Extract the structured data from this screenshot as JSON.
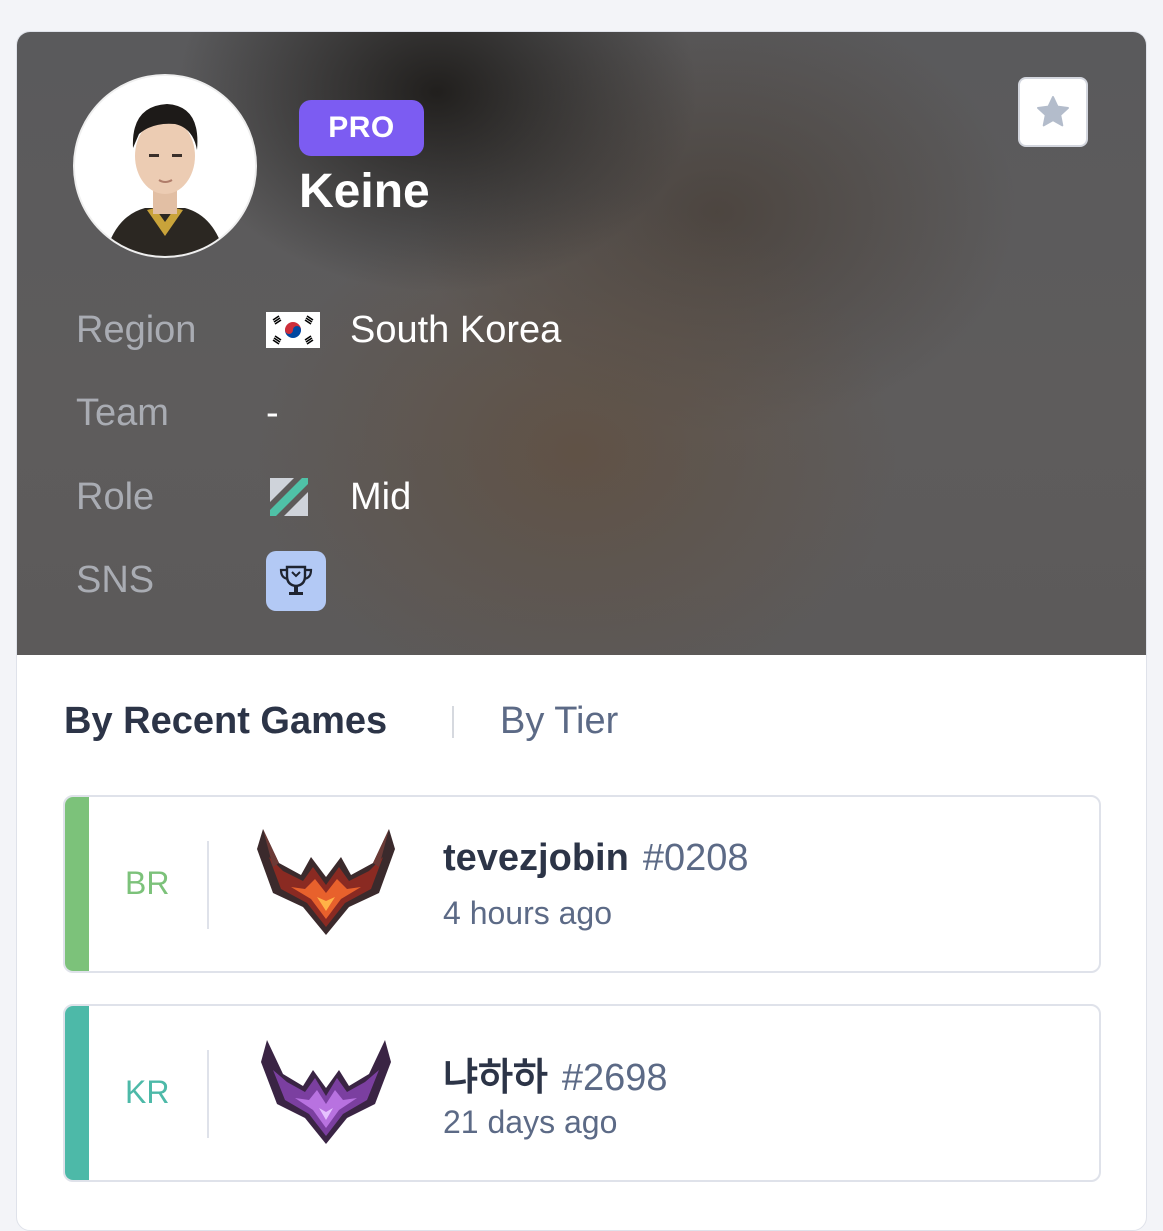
{
  "profile": {
    "badge": "PRO",
    "name": "Keine",
    "info": {
      "region_label": "Region",
      "region_value": "South Korea",
      "team_label": "Team",
      "team_value": "-",
      "role_label": "Role",
      "role_value": "Mid",
      "sns_label": "SNS"
    },
    "icons": {
      "favorite": "star-icon",
      "flag": "south-korea-flag-icon",
      "role": "mid-lane-icon",
      "sns": "trophy-icon"
    }
  },
  "tabs": [
    {
      "label": "By Recent Games",
      "active": true
    },
    {
      "label": "By Tier",
      "active": false
    }
  ],
  "accounts": [
    {
      "region": "BR",
      "name": "tevezjobin",
      "tag": "#0208",
      "time": "4 hours ago",
      "tier_icon": "grandmaster-emblem",
      "accent_color": "#7cc27a"
    },
    {
      "region": "KR",
      "name": "냐하하",
      "tag": "#2698",
      "time": "21 days ago",
      "tier_icon": "master-emblem",
      "accent_color": "#4db9a8"
    }
  ],
  "colors": {
    "pro_badge": "#7c5cf2",
    "sns_button": "#b3c9f5",
    "text_dark": "#2c3447",
    "text_muted": "#5c6a86"
  }
}
